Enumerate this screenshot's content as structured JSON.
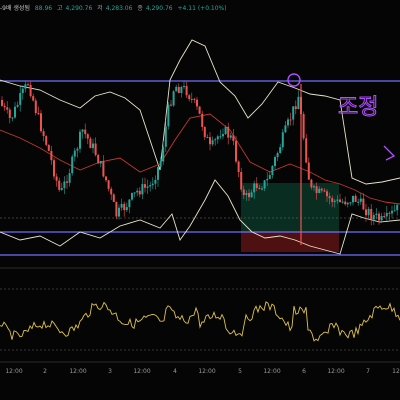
{
  "header": {
    "pair_interval": "-9배 생성됨",
    "open": "88.96",
    "high_label": "고",
    "high": "4,290.76",
    "low_label": "저",
    "low": "4,283.06",
    "close_label": "종",
    "close": "4,290.76",
    "change": "+4.11 (+0.10%)"
  },
  "annotation": {
    "handwritten_text": "조정"
  },
  "time_axis": {
    "labels": [
      "12:00",
      "2",
      "12:00",
      "3",
      "12:00",
      "4",
      "12:00",
      "5",
      "12:00",
      "6",
      "12:00",
      "7",
      "12:"
    ]
  },
  "colors": {
    "background": "#050505",
    "candle_up": "#26a69a",
    "candle_down": "#ef5350",
    "bollinger_band": "#e8e4c8",
    "moving_average": "#c0392b",
    "horizontal_lines": "#6f6fff",
    "lower_box": "#8b1a1a",
    "upper_box": "#0f4f3a",
    "oscillator": "#e0c34a",
    "annotation_pen": "#b24dff"
  }
}
